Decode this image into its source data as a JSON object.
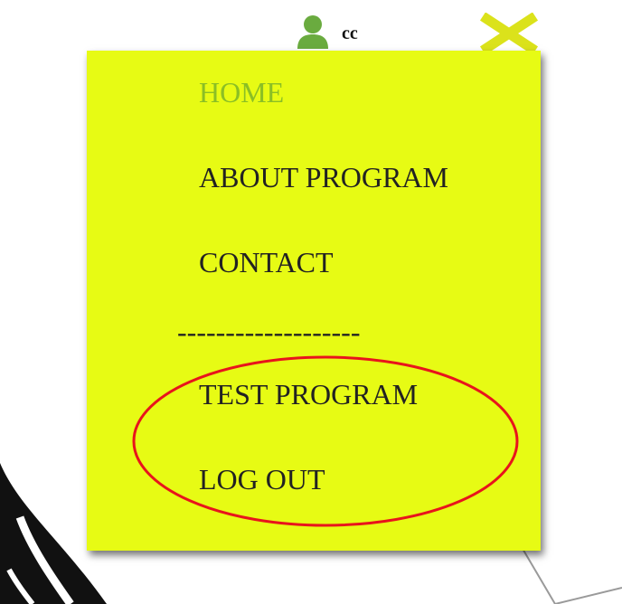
{
  "user": {
    "name": "cc",
    "icon": "person-icon"
  },
  "close_icon": "close-x-icon",
  "menu": {
    "items": [
      {
        "label": "HOME",
        "active": true
      },
      {
        "label": "ABOUT PROGRAM",
        "active": false
      },
      {
        "label": "CONTACT",
        "active": false
      },
      {
        "label": "TEST PROGRAM",
        "active": false
      },
      {
        "label": "LOG OUT",
        "active": false
      }
    ],
    "separator": "-------------------"
  },
  "colors": {
    "panel_background": "#e7fb14",
    "active_item": "#8bbf25",
    "item_text": "#222222",
    "close_icon": "#dbe21b",
    "user_icon": "#6aab3f",
    "annotation_ellipse": "#e8141c"
  }
}
